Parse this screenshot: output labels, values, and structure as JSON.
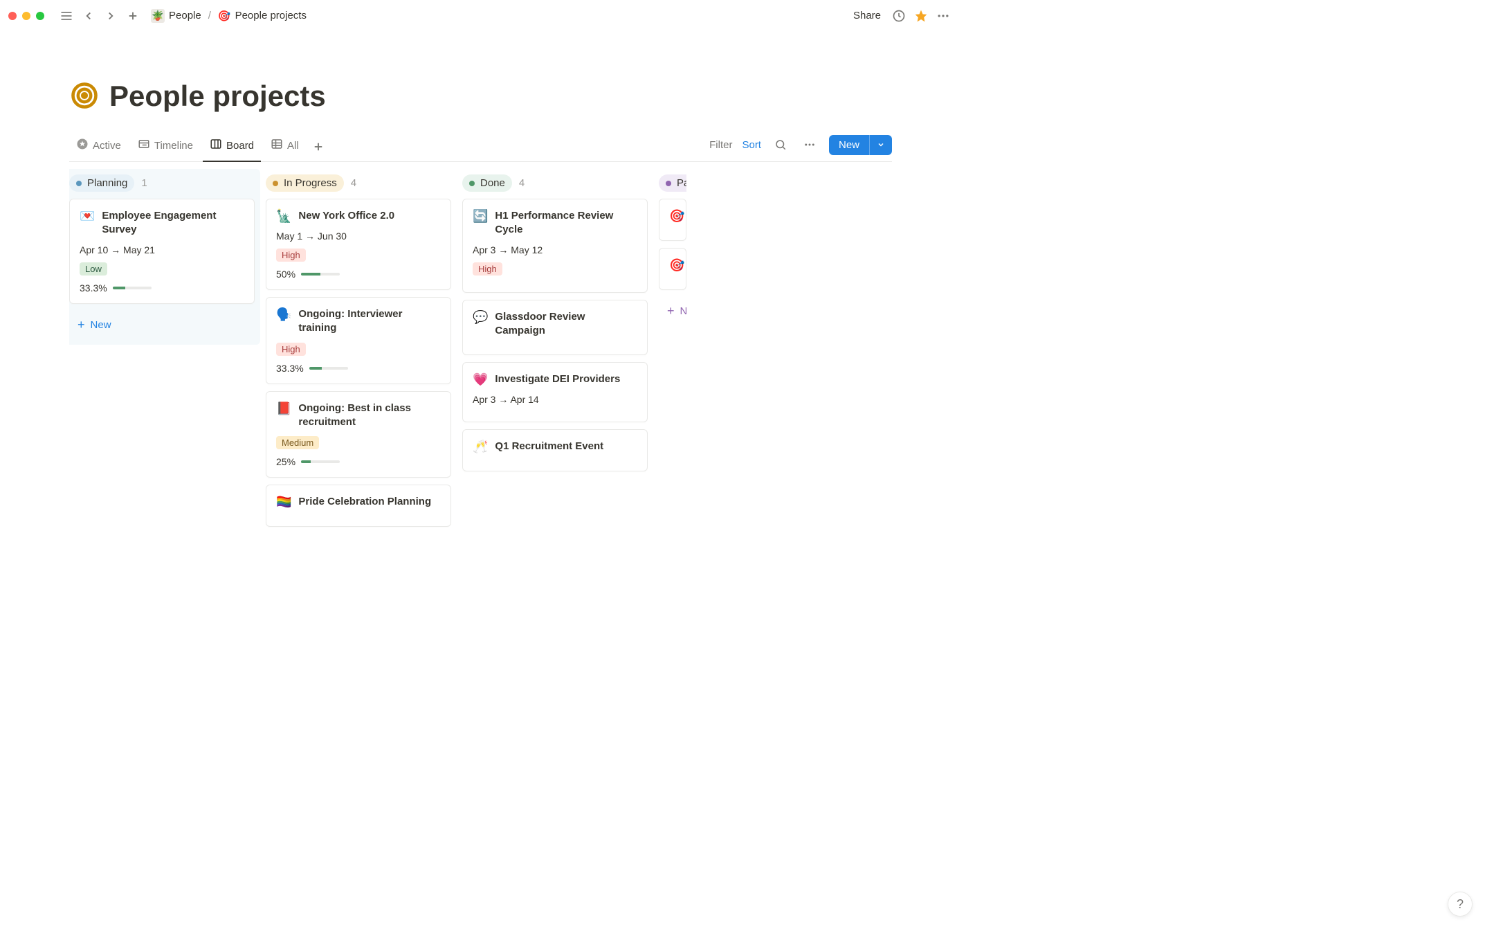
{
  "breadcrumb": {
    "parent_icon": "🪴",
    "parent_label": "People",
    "current_icon": "🎯",
    "current_label": "People projects"
  },
  "topbar": {
    "share_label": "Share"
  },
  "page": {
    "icon": "🎯",
    "title": "People projects"
  },
  "views": {
    "tabs": [
      {
        "icon": "star",
        "label": "Active"
      },
      {
        "icon": "timeline",
        "label": "Timeline"
      },
      {
        "icon": "board",
        "label": "Board"
      },
      {
        "icon": "table",
        "label": "All"
      }
    ],
    "filter_label": "Filter",
    "sort_label": "Sort",
    "new_label": "New"
  },
  "board": {
    "columns": [
      {
        "key": "planning",
        "label": "Planning",
        "count": "1",
        "pill_class": "pill-planning",
        "bg_wrap": true,
        "add_label": "New",
        "cards": [
          {
            "icon": "💌",
            "title": "Employee Engagement Survey",
            "date": "Apr 10 → May 21",
            "priority": "Low",
            "priority_class": "tag-low",
            "progress_text": "33.3%",
            "progress_pct": 33.3
          }
        ]
      },
      {
        "key": "in_progress",
        "label": "In Progress",
        "count": "4",
        "pill_class": "pill-progress",
        "cards": [
          {
            "icon": "🗽",
            "title": "New York Office 2.0",
            "date": "May 1 → Jun 30",
            "priority": "High",
            "priority_class": "tag-high",
            "progress_text": "50%",
            "progress_pct": 50
          },
          {
            "icon": "🗣️",
            "title": "Ongoing: Interviewer training",
            "priority": "High",
            "priority_class": "tag-high",
            "progress_text": "33.3%",
            "progress_pct": 33.3
          },
          {
            "icon": "📕",
            "title": "Ongoing: Best in class recruitment",
            "priority": "Medium",
            "priority_class": "tag-medium",
            "progress_text": "25%",
            "progress_pct": 25
          },
          {
            "icon": "🏳️‍🌈",
            "title": "Pride Celebration Planning"
          }
        ]
      },
      {
        "key": "done",
        "label": "Done",
        "count": "4",
        "pill_class": "pill-done",
        "cards": [
          {
            "icon": "🔄",
            "title": "H1 Performance Review Cycle",
            "date": "Apr 3 → May 12",
            "priority": "High",
            "priority_class": "tag-high"
          },
          {
            "icon": "💬",
            "title": "Glassdoor Review Campaign"
          },
          {
            "icon": "💗",
            "title": "Investigate DEI Providers",
            "date": "Apr 3 → Apr 14"
          },
          {
            "icon": "🥂",
            "title": "Q1 Recruitment Event"
          }
        ]
      },
      {
        "key": "paused",
        "label": "Pa",
        "pill_class": "pill-paused",
        "partial": true,
        "add_label": "N",
        "add_class": "add-card-purple",
        "cards": [
          {
            "icon": "🎯"
          },
          {
            "icon": "🎯"
          }
        ]
      }
    ]
  }
}
